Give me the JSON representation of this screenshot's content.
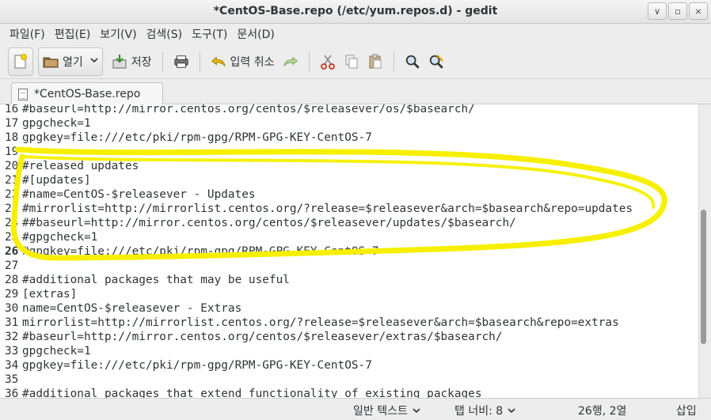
{
  "window": {
    "title": "*CentOS-Base.repo (/etc/yum.repos.d) - gedit",
    "buttons": [
      "∨",
      "▫",
      "×"
    ]
  },
  "menubar": [
    "파일(F)",
    "편집(E)",
    "보기(V)",
    "검색(S)",
    "도구(T)",
    "문서(D)"
  ],
  "toolbar": {
    "open_label": "열기",
    "save_label": "저장",
    "undo_label": "입력 취소"
  },
  "tab": {
    "label": "*CentOS-Base.repo"
  },
  "editor": {
    "current_line": 26,
    "highlight_color": "#f6f000",
    "lines": [
      {
        "n": "16",
        "text": "#baseurl=http://mirror.centos.org/centos/$releasever/os/$basearch/"
      },
      {
        "n": "17",
        "text": "gpgcheck=1"
      },
      {
        "n": "18",
        "text": "gpgkey=file:///etc/pki/rpm-gpg/RPM-GPG-KEY-CentOS-7"
      },
      {
        "n": "19",
        "text": ""
      },
      {
        "n": "20",
        "text": "#released updates"
      },
      {
        "n": "21",
        "text": "#[updates]"
      },
      {
        "n": "22",
        "text": "#name=CentOS-$releasever - Updates"
      },
      {
        "n": "23",
        "text": "#mirrorlist=http://mirrorlist.centos.org/?release=$releasever&arch=$basearch&repo=updates"
      },
      {
        "n": "24",
        "text": "##baseurl=http://mirror.centos.org/centos/$releasever/updates/$basearch/"
      },
      {
        "n": "25",
        "text": "#gpgcheck=1"
      },
      {
        "n": "26",
        "text": "#gpgkey=file:///etc/pki/rpm-gpg/RPM-GPG-KEY-CentOS-7"
      },
      {
        "n": "27",
        "text": ""
      },
      {
        "n": "28",
        "text": "#additional packages that may be useful"
      },
      {
        "n": "29",
        "text": "[extras]"
      },
      {
        "n": "30",
        "text": "name=CentOS-$releasever - Extras"
      },
      {
        "n": "31",
        "text": "mirrorlist=http://mirrorlist.centos.org/?release=$releasever&arch=$basearch&repo=extras"
      },
      {
        "n": "32",
        "text": "#baseurl=http://mirror.centos.org/centos/$releasever/extras/$basearch/"
      },
      {
        "n": "33",
        "text": "gpgcheck=1"
      },
      {
        "n": "34",
        "text": "gpgkey=file:///etc/pki/rpm-gpg/RPM-GPG-KEY-CentOS-7"
      },
      {
        "n": "35",
        "text": ""
      },
      {
        "n": "36",
        "text": "#additional packages that extend functionality of existing packages"
      }
    ]
  },
  "statusbar": {
    "syntax": "일반 텍스트",
    "tab_width": "탭 너비:  8",
    "position": "26행, 2열",
    "mode": "삽입"
  }
}
